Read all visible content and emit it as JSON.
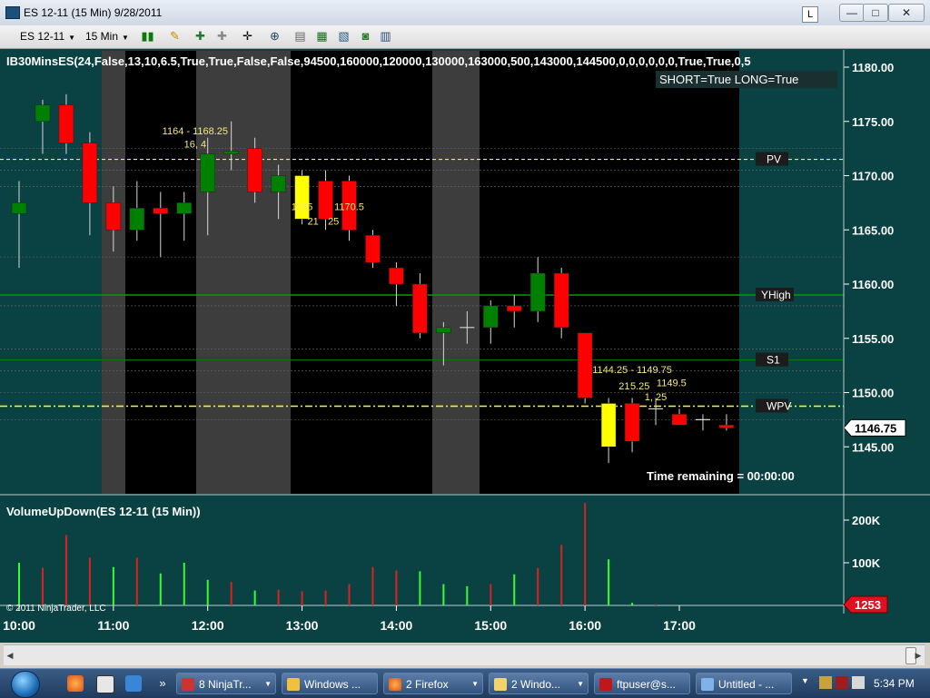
{
  "window": {
    "title": "ES 12-11 (15 Min)  9/28/2011",
    "link_btn": "L",
    "minimize": "—",
    "maximize": "□",
    "close": "✕"
  },
  "toolbar": {
    "instrument": "ES 12-11",
    "interval": "15 Min",
    "icons": [
      "bar-type-icon",
      "pencil-icon",
      "indicator-icon",
      "strategy-icon",
      "crosshair-icon",
      "zoom-icon",
      "data-box-icon",
      "chart-trader-icon",
      "properties-icon",
      "snapshot-icon",
      "panel-icon"
    ]
  },
  "colors": {
    "bg_panel": "#0a4243",
    "bg_session": "#000000",
    "bg_gray": "#3d3d3d",
    "up": "#008000",
    "down": "#ff0000",
    "doji": "#ffff00",
    "blue": "#0000ff",
    "pv_line": "#ffff00",
    "yhigh_line": "#00a000",
    "s1_line": "#008000",
    "wpv_line": "#ffff00"
  },
  "chart_data": [
    {
      "type": "candlestick",
      "indicator_label": "IB30MinsES(24,False,13,10,6.5,True,True,False,False,94500,160000,120000,130000,163000,500,143000,144500,0,0,0,0,0,0,True,True,0,5",
      "status_text": "SHORT=True LONG=True",
      "time_remaining": "Time remaining = 00:00:00",
      "y_ticks": [
        "1180.00",
        "1175.00",
        "1170.00",
        "1165.00",
        "1160.00",
        "1155.00",
        "1150.00",
        "1145.00"
      ],
      "ylim": [
        1142.0,
        1181.0
      ],
      "price_tag": "1146.75",
      "x_ticks": [
        "10:00",
        "11:00",
        "12:00",
        "13:00",
        "14:00",
        "15:00",
        "16:00",
        "17:00"
      ],
      "levels": [
        {
          "name": "PV",
          "value": 1171.5
        },
        {
          "name": "YHigh",
          "value": 1159.0
        },
        {
          "name": "S1",
          "value": 1153.0
        },
        {
          "name": "WPV",
          "value": 1148.75
        }
      ],
      "annotations": [
        {
          "text": "1164 - 1168.25",
          "time": "11:52",
          "price": 1173.8
        },
        {
          "text": "16, 4",
          "time": "11:52",
          "price": 1172.6
        },
        {
          "text": "1165",
          "time": "13:00",
          "price": 1166.8
        },
        {
          "text": "1170.5",
          "time": "13:30",
          "price": 1166.8
        },
        {
          "text": "21",
          "time": "13:07",
          "price": 1165.5
        },
        {
          "text": "25",
          "time": "13:20",
          "price": 1165.5
        },
        {
          "text": "1144.25 - 1149.75",
          "time": "16:30",
          "price": 1151.8
        },
        {
          "text": "21",
          "time": "16:25",
          "price": 1150.3
        },
        {
          "text": "5.25",
          "time": "16:35",
          "price": 1150.3
        },
        {
          "text": "1149.5",
          "time": "16:55",
          "price": 1150.6
        },
        {
          "text": "1, 25",
          "time": "16:45",
          "price": 1149.3
        }
      ],
      "candles": [
        {
          "time": "10:00",
          "o": 1166.5,
          "h": 1169.5,
          "l": 1161.5,
          "c": 1167.5
        },
        {
          "time": "10:15",
          "o": 1175.0,
          "h": 1177.0,
          "l": 1172.0,
          "c": 1176.5
        },
        {
          "time": "10:30",
          "o": 1176.5,
          "h": 1177.5,
          "l": 1172.0,
          "c": 1173.0
        },
        {
          "time": "10:45",
          "o": 1173.0,
          "h": 1174.0,
          "l": 1164.5,
          "c": 1167.5
        },
        {
          "time": "11:00",
          "o": 1167.5,
          "h": 1169.0,
          "l": 1163.0,
          "c": 1165.0
        },
        {
          "time": "11:15",
          "o": 1165.0,
          "h": 1169.5,
          "l": 1164.0,
          "c": 1167.0
        },
        {
          "time": "11:30",
          "o": 1167.0,
          "h": 1168.5,
          "l": 1162.5,
          "c": 1166.5
        },
        {
          "time": "11:45",
          "o": 1166.5,
          "h": 1168.5,
          "l": 1164.0,
          "c": 1167.5
        },
        {
          "time": "12:00",
          "o": 1168.5,
          "h": 1173.5,
          "l": 1164.5,
          "c": 1172.0
        },
        {
          "time": "12:15",
          "o": 1172.0,
          "h": 1175.0,
          "l": 1170.5,
          "c": 1172.25
        },
        {
          "time": "12:30",
          "o": 1172.5,
          "h": 1173.5,
          "l": 1167.5,
          "c": 1168.5
        },
        {
          "time": "12:45",
          "o": 1168.5,
          "h": 1171.0,
          "l": 1166.0,
          "c": 1170.0
        },
        {
          "time": "13:00",
          "o": 1170.0,
          "h": 1170.5,
          "l": 1165.5,
          "c": 1166.0
        },
        {
          "time": "13:15",
          "o": 1169.5,
          "h": 1170.5,
          "l": 1165.0,
          "c": 1166.0
        },
        {
          "time": "13:30",
          "o": 1169.5,
          "h": 1170.0,
          "l": 1164.0,
          "c": 1165.0
        },
        {
          "time": "13:45",
          "o": 1164.5,
          "h": 1165.0,
          "l": 1161.5,
          "c": 1162.0
        },
        {
          "time": "14:00",
          "o": 1161.5,
          "h": 1162.0,
          "l": 1158.0,
          "c": 1160.0
        },
        {
          "time": "14:15",
          "o": 1160.0,
          "h": 1161.0,
          "l": 1155.0,
          "c": 1155.5
        },
        {
          "time": "14:30",
          "o": 1155.5,
          "h": 1156.5,
          "l": 1152.5,
          "c": 1156.0
        },
        {
          "time": "14:45",
          "o": 1156.0,
          "h": 1157.5,
          "l": 1154.5,
          "c": 1156.0
        },
        {
          "time": "15:00",
          "o": 1156.0,
          "h": 1158.5,
          "l": 1154.5,
          "c": 1158.0
        },
        {
          "time": "15:15",
          "o": 1158.0,
          "h": 1159.0,
          "l": 1156.0,
          "c": 1157.5
        },
        {
          "time": "15:30",
          "o": 1157.5,
          "h": 1162.5,
          "l": 1156.5,
          "c": 1161.0
        },
        {
          "time": "15:45",
          "o": 1161.0,
          "h": 1161.5,
          "l": 1155.0,
          "c": 1156.0
        },
        {
          "time": "16:00",
          "o": 1155.5,
          "h": 1155.5,
          "l": 1149.0,
          "c": 1149.5
        },
        {
          "time": "16:15",
          "o": 1149.0,
          "h": 1149.5,
          "l": 1143.5,
          "c": 1145.0
        },
        {
          "time": "16:30",
          "o": 1149.0,
          "h": 1149.5,
          "l": 1144.5,
          "c": 1145.5
        },
        {
          "time": "16:45",
          "o": 1148.5,
          "h": 1149.5,
          "l": 1147.0,
          "c": 1148.5
        },
        {
          "time": "17:00",
          "o": 1148.0,
          "h": 1148.5,
          "l": 1147.0,
          "c": 1147.0
        },
        {
          "time": "17:15",
          "o": 1147.5,
          "h": 1148.0,
          "l": 1146.5,
          "c": 1147.5
        },
        {
          "time": "17:30",
          "o": 1147.0,
          "h": 1148.0,
          "l": 1146.5,
          "c": 1146.75
        }
      ]
    },
    {
      "type": "bar",
      "indicator_label": "VolumeUpDown(ES 12-11 (15 Min))",
      "copyright": "© 2011 NinjaTrader, LLC",
      "y_ticks": [
        "200K",
        "100K"
      ],
      "ylim": [
        0,
        260000
      ],
      "value_tag": "1253",
      "values": [
        {
          "time": "10:00",
          "v": 100000,
          "dir": "up"
        },
        {
          "time": "10:15",
          "v": 88000,
          "dir": "down"
        },
        {
          "time": "10:30",
          "v": 165000,
          "dir": "down"
        },
        {
          "time": "10:45",
          "v": 112000,
          "dir": "down"
        },
        {
          "time": "11:00",
          "v": 90000,
          "dir": "up"
        },
        {
          "time": "11:15",
          "v": 112000,
          "dir": "down"
        },
        {
          "time": "11:30",
          "v": 75000,
          "dir": "up"
        },
        {
          "time": "11:45",
          "v": 100000,
          "dir": "up"
        },
        {
          "time": "12:00",
          "v": 60000,
          "dir": "up"
        },
        {
          "time": "12:15",
          "v": 55000,
          "dir": "down"
        },
        {
          "time": "12:30",
          "v": 35000,
          "dir": "up"
        },
        {
          "time": "12:45",
          "v": 37000,
          "dir": "down"
        },
        {
          "time": "13:00",
          "v": 33000,
          "dir": "down"
        },
        {
          "time": "13:15",
          "v": 35000,
          "dir": "down"
        },
        {
          "time": "13:30",
          "v": 50000,
          "dir": "down"
        },
        {
          "time": "13:45",
          "v": 90000,
          "dir": "down"
        },
        {
          "time": "14:00",
          "v": 82000,
          "dir": "down"
        },
        {
          "time": "14:15",
          "v": 80000,
          "dir": "up"
        },
        {
          "time": "14:30",
          "v": 50000,
          "dir": "up"
        },
        {
          "time": "14:45",
          "v": 45000,
          "dir": "up"
        },
        {
          "time": "15:00",
          "v": 50000,
          "dir": "down"
        },
        {
          "time": "15:15",
          "v": 73000,
          "dir": "up"
        },
        {
          "time": "15:30",
          "v": 88000,
          "dir": "down"
        },
        {
          "time": "15:45",
          "v": 142000,
          "dir": "down"
        },
        {
          "time": "16:00",
          "v": 240000,
          "dir": "down"
        },
        {
          "time": "16:15",
          "v": 108000,
          "dir": "up"
        },
        {
          "time": "16:30",
          "v": 6000,
          "dir": "up"
        },
        {
          "time": "16:45",
          "v": 3000,
          "dir": "down"
        }
      ]
    }
  ],
  "taskbar": {
    "items": [
      {
        "label": "8 NinjaTr...",
        "icon": "ninjatrader-icon"
      },
      {
        "label": "Windows ...",
        "icon": "window-icon"
      },
      {
        "label": "2 Firefox",
        "icon": "firefox-icon"
      },
      {
        "label": "2 Windo...",
        "icon": "folder-icon"
      },
      {
        "label": "ftpuser@s...",
        "icon": "filezilla-icon"
      },
      {
        "label": "Untitled - ...",
        "icon": "notepad-icon"
      }
    ],
    "clock": "5:34 PM",
    "overflow": "»"
  }
}
